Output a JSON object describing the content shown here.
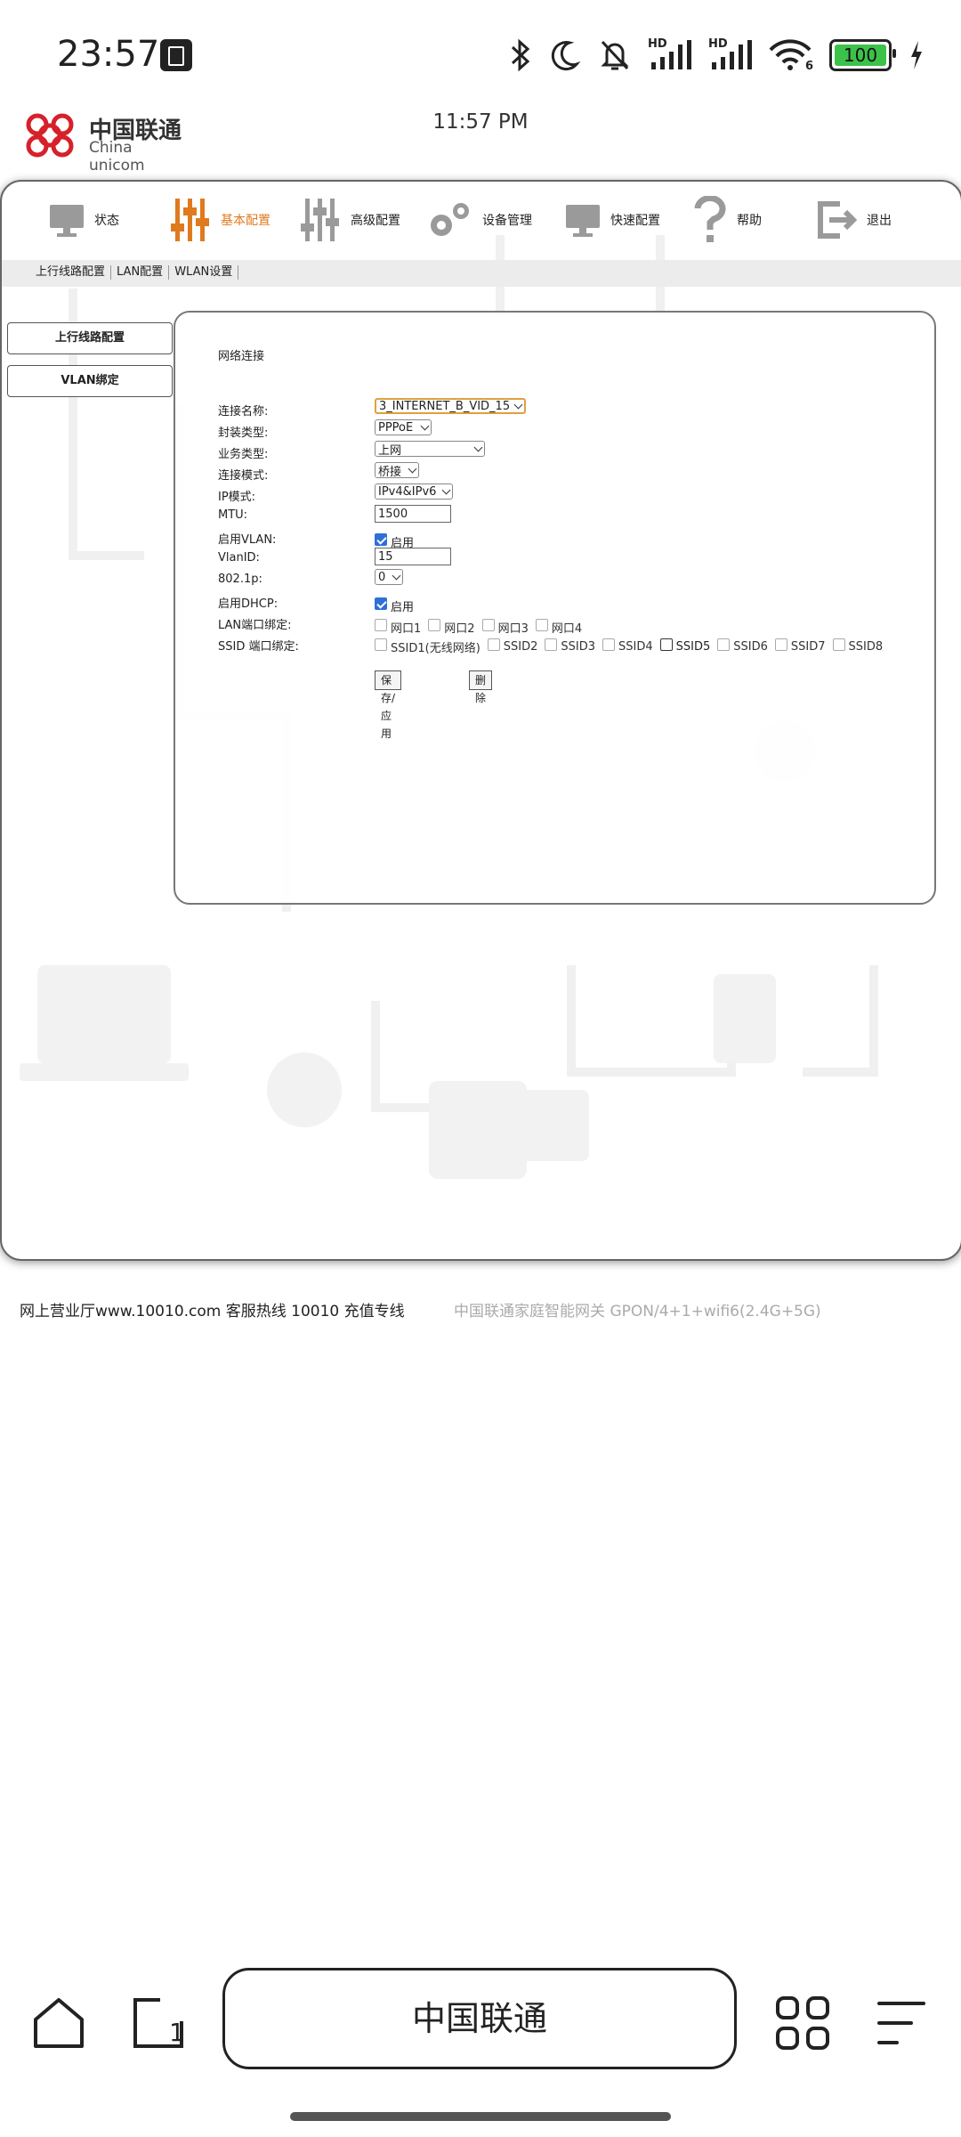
{
  "status_bar": {
    "time": "23:57",
    "icons": [
      "bluetooth-icon",
      "moon-icon",
      "bell-off-icon",
      "signal-hd-icon",
      "signal-hd-icon",
      "wifi6-icon",
      "battery-icon",
      "charging-icon"
    ],
    "hd_label": "HD",
    "wifi_label": "6",
    "battery_level": "100"
  },
  "browser": {
    "logo_cn": "中国联通",
    "logo_en": "China unicom",
    "page_time": "11:57 PM",
    "url_title": "中国联通"
  },
  "nav": {
    "items": [
      {
        "label": "状态",
        "icon": "monitor-icon"
      },
      {
        "label": "基本配置",
        "icon": "sliders-icon",
        "active": true
      },
      {
        "label": "高级配置",
        "icon": "sliders-advanced-icon"
      },
      {
        "label": "设备管理",
        "icon": "gears-icon"
      },
      {
        "label": "快速配置",
        "icon": "monitor-quick-icon"
      },
      {
        "label": "帮助",
        "icon": "question-icon"
      },
      {
        "label": "退出",
        "icon": "exit-icon"
      }
    ],
    "active_color": "#e07a1f"
  },
  "subnav": {
    "items": [
      "上行线路配置",
      "LAN配置",
      "WLAN设置"
    ]
  },
  "sidebar": {
    "items": [
      "上行线路配置",
      "VLAN绑定"
    ]
  },
  "form": {
    "section_title": "网络连接",
    "connection_name_label": "连接名称:",
    "connection_name_value": "3_INTERNET_B_VID_15",
    "encap_label": "封装类型:",
    "encap_value": "PPPoE",
    "service_label": "业务类型:",
    "service_value": "上网",
    "mode_label": "连接模式:",
    "mode_value": "桥接",
    "ip_mode_label": "IP模式:",
    "ip_mode_value": "IPv4&IPv6",
    "mtu_label": "MTU:",
    "mtu_value": "1500",
    "vlan_enable_label": "启用VLAN:",
    "enable_text": "启用",
    "vlanid_label": "VlanID:",
    "vlanid_value": "15",
    "p8021_label": "802.1p:",
    "p8021_value": "0",
    "dhcp_label": "启用DHCP:",
    "lan_bind_label": "LAN端口绑定:",
    "lan_ports": [
      "网口1",
      "网口2",
      "网口3",
      "网口4"
    ],
    "ssid_bind_label": "SSID 端口绑定:",
    "ssids": [
      "SSID1(无线网络)",
      "SSID2",
      "SSID3",
      "SSID4",
      "SSID5",
      "SSID6",
      "SSID7",
      "SSID8"
    ],
    "save_button": "保存/应用",
    "delete_button": "删除"
  },
  "footer": {
    "left": "网上营业厅www.10010.com 客服热线 10010 充值专线",
    "right": "中国联通家庭智能网关 GPON/4+1+wifi6(2.4G+5G)"
  }
}
